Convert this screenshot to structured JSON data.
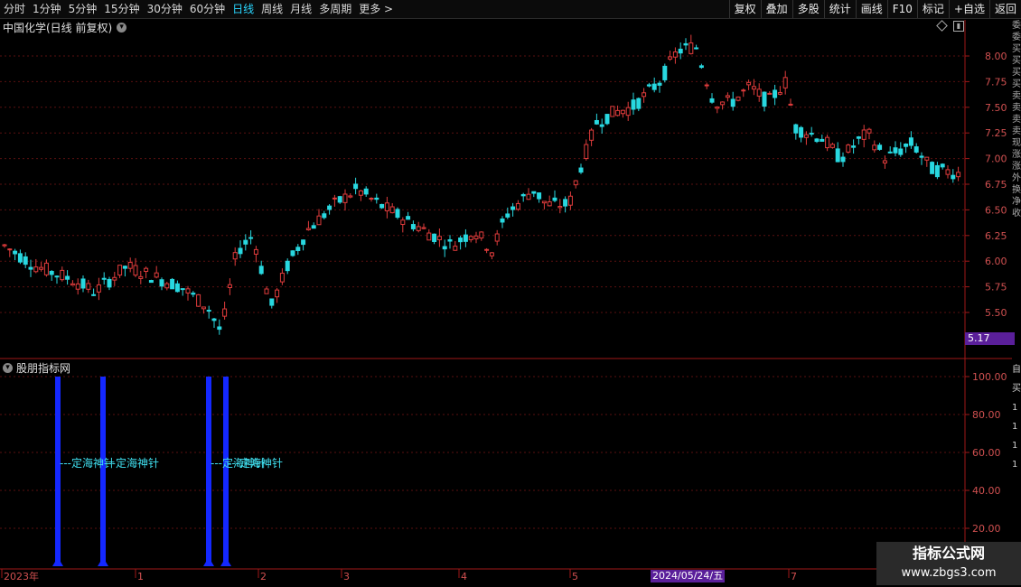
{
  "toolbar": {
    "periods": [
      "分时",
      "1分钟",
      "5分钟",
      "15分钟",
      "30分钟",
      "60分钟",
      "日线",
      "周线",
      "月线",
      "多周期",
      "更多 >"
    ],
    "active_period": "日线",
    "actions": [
      "复权",
      "叠加",
      "多股",
      "统计",
      "画线",
      "F10",
      "标记",
      "+自选",
      "返回"
    ]
  },
  "main_chart": {
    "title": "中国化学(日线 前复权)",
    "price_ticks": [
      "8.00",
      "7.75",
      "7.50",
      "7.25",
      "7.00",
      "6.75",
      "6.50",
      "6.25",
      "6.00",
      "5.75",
      "5.50"
    ],
    "last_price_tag": "5.17",
    "colors": {
      "up": "#e03c3c",
      "down": "#28d8e0",
      "grid": "#5a1010"
    }
  },
  "sub_chart": {
    "title": "股朋指标网",
    "ticks": [
      "100.00",
      "80.00",
      "60.00",
      "40.00",
      "20.00"
    ],
    "signal_label": "---定海神针",
    "bar_color": "#1428ff"
  },
  "x_axis": {
    "labels": [
      "2023年",
      "1",
      "2",
      "3",
      "4",
      "5",
      "7"
    ],
    "highlight_date": "2024/05/24/五"
  },
  "watermark": {
    "title": "指标公式网",
    "url": "www.zbgs3.com"
  },
  "right_edge_text": {
    "main": [
      "委",
      "委",
      "买",
      "买",
      "买",
      "买",
      "卖",
      "卖",
      "卖",
      "卖",
      "现",
      "涨",
      "涨",
      "外",
      "换",
      "净",
      "收"
    ],
    "sub": [
      "自",
      "买",
      "1",
      "1",
      "1",
      "1"
    ]
  }
}
